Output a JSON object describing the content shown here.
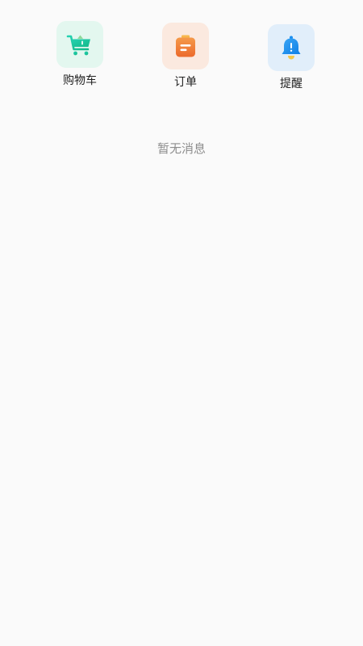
{
  "shortcuts": {
    "cart": {
      "label": "购物车",
      "icon": "shopping-cart-icon",
      "color": "#1fc9a0"
    },
    "orders": {
      "label": "订单",
      "icon": "clipboard-icon",
      "color": "#f07a3a"
    },
    "reminders": {
      "label": "提醒",
      "icon": "bell-icon",
      "color": "#1a8ef0"
    }
  },
  "empty_state": {
    "message": "暂无消息"
  }
}
